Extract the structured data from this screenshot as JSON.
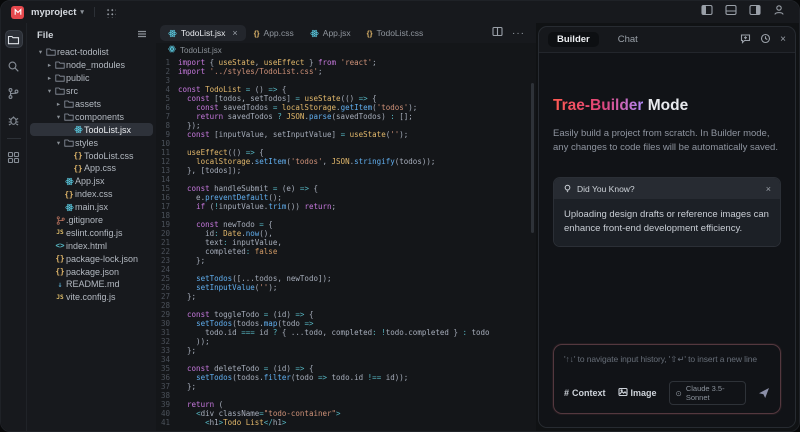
{
  "topbar": {
    "project_name": "myproject"
  },
  "icons": {
    "chevron_down": "▾",
    "chevron_right": "▸",
    "chevron_expanded": "▾",
    "close": "×",
    "more": "···",
    "hash": "#",
    "model_dot": "⊙",
    "braces": "{}",
    "js_badge": "JS",
    "html_tags": "<>",
    "md_arrow": "↓"
  },
  "colors": {
    "accent_red": "#e5484d",
    "gradient_start": "#ff5a52",
    "gradient_end": "#b18af8",
    "react_cyan": "#5ccfe6",
    "selection_bg": "#2e323a"
  },
  "activity_bar": {
    "items": [
      "files",
      "search",
      "source-control",
      "debug",
      "extensions"
    ],
    "active": "files"
  },
  "explorer": {
    "header": "File",
    "tree": [
      {
        "label": "react-todolist",
        "depth": 0,
        "kind": "folder",
        "expanded": true
      },
      {
        "label": "node_modules",
        "depth": 1,
        "kind": "folder",
        "expanded": false
      },
      {
        "label": "public",
        "depth": 1,
        "kind": "folder",
        "expanded": false
      },
      {
        "label": "src",
        "depth": 1,
        "kind": "folder",
        "expanded": true
      },
      {
        "label": "assets",
        "depth": 2,
        "kind": "folder",
        "expanded": false
      },
      {
        "label": "components",
        "depth": 2,
        "kind": "folder",
        "expanded": true
      },
      {
        "label": "TodoList.jsx",
        "depth": 3,
        "kind": "react",
        "selected": true
      },
      {
        "label": "styles",
        "depth": 2,
        "kind": "folder",
        "expanded": true
      },
      {
        "label": "TodoList.css",
        "depth": 3,
        "kind": "braces"
      },
      {
        "label": "App.css",
        "depth": 3,
        "kind": "braces"
      },
      {
        "label": "App.jsx",
        "depth": 2,
        "kind": "react"
      },
      {
        "label": "index.css",
        "depth": 2,
        "kind": "braces"
      },
      {
        "label": "main.jsx",
        "depth": 2,
        "kind": "react"
      },
      {
        "label": ".gitignore",
        "depth": 1,
        "kind": "git"
      },
      {
        "label": "eslint.config.js",
        "depth": 1,
        "kind": "js"
      },
      {
        "label": "index.html",
        "depth": 1,
        "kind": "html"
      },
      {
        "label": "package-lock.json",
        "depth": 1,
        "kind": "braces"
      },
      {
        "label": "package.json",
        "depth": 1,
        "kind": "braces"
      },
      {
        "label": "README.md",
        "depth": 1,
        "kind": "md"
      },
      {
        "label": "vite.config.js",
        "depth": 1,
        "kind": "js"
      }
    ]
  },
  "editor": {
    "tabs": [
      {
        "label": "TodoList.jsx",
        "kind": "react",
        "active": true,
        "closable": true
      },
      {
        "label": "App.css",
        "kind": "braces",
        "active": false,
        "closable": false
      },
      {
        "label": "App.jsx",
        "kind": "react",
        "active": false,
        "closable": false
      },
      {
        "label": "TodoList.css",
        "kind": "braces",
        "active": false,
        "closable": false
      }
    ],
    "breadcrumb": "TodoList.jsx",
    "code_lines": [
      "import { useState, useEffect } from 'react';",
      "import '../styles/TodoList.css';",
      "",
      "const TodoList = () => {",
      "  const [todos, setTodos] = useState(() => {",
      "    const savedTodos = localStorage.getItem('todos');",
      "    return savedTodos ? JSON.parse(savedTodos) : [];",
      "  });",
      "  const [inputValue, setInputValue] = useState('');",
      "",
      "  useEffect(() => {",
      "    localStorage.setItem('todos', JSON.stringify(todos));",
      "  }, [todos]);",
      "",
      "  const handleSubmit = (e) => {",
      "    e.preventDefault();",
      "    if (!inputValue.trim()) return;",
      "",
      "    const newTodo = {",
      "      id: Date.now(),",
      "      text: inputValue,",
      "      completed: false",
      "    };",
      "",
      "    setTodos([...todos, newTodo]);",
      "    setInputValue('');",
      "  };",
      "",
      "  const toggleTodo = (id) => {",
      "    setTodos(todos.map(todo =>",
      "      todo.id === id ? { ...todo, completed: !todo.completed } : todo",
      "    ));",
      "  };",
      "",
      "  const deleteTodo = (id) => {",
      "    setTodos(todos.filter(todo => todo.id !== id));",
      "  };",
      "",
      "  return (",
      "    <div className=\"todo-container\">",
      "      <h1>Todo List</h1>"
    ]
  },
  "assistant": {
    "tabs": [
      "Builder",
      "Chat"
    ],
    "active_tab": "Builder",
    "title_gradient": "Trae-Builder",
    "title_rest": " Mode",
    "subtitle": "Easily build a project from scratch. In Builder mode, any changes to code files will be automatically saved.",
    "tip_card": {
      "header": "Did You Know?",
      "body": "Uploading design drafts or reference images can enhance front-end development efficiency."
    },
    "input": {
      "placeholder": "'↑↓' to navigate input history, '⇧↵' to insert a new line"
    },
    "footer": {
      "context_label": "Context",
      "image_label": "Image",
      "model_label": "Claude 3.5-Sonnet"
    }
  }
}
